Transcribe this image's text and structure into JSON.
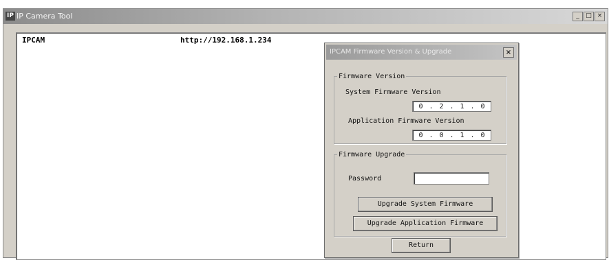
{
  "window": {
    "title": "IP Camera Tool",
    "minimize": "_",
    "maximize": "□",
    "close": "×"
  },
  "camera_list": [
    {
      "name": "IPCAM",
      "url": "http://192.168.1.234"
    }
  ],
  "dialog": {
    "title": "IPCAM Firmware Version & Upgrade",
    "close": "×",
    "firmware_version": {
      "legend": "Firmware Version",
      "system_label": "System Firmware Version",
      "system_value": [
        "0",
        "2",
        "1",
        "0"
      ],
      "application_label": "Application Firmware Version",
      "application_value": [
        "0",
        "0",
        "1",
        "0"
      ]
    },
    "firmware_upgrade": {
      "legend": "Firmware Upgrade",
      "password_label": "Password",
      "password_value": "",
      "upgrade_system_button": "Upgrade System Firmware",
      "upgrade_application_button": "Upgrade Application Firmware"
    },
    "return_button": "Return"
  }
}
